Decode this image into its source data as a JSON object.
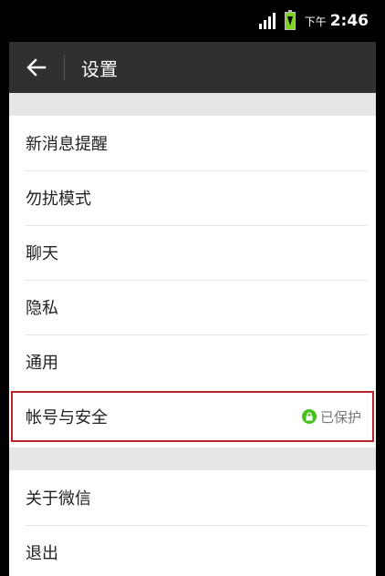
{
  "status_bar": {
    "time_period": "下午",
    "time": "2:46",
    "icons": [
      "signal-icon",
      "battery-charging-icon"
    ]
  },
  "header": {
    "back_icon": "arrow-left-icon",
    "title": "设置",
    "background": "#303033"
  },
  "settings": {
    "group1": [
      {
        "label": "新消息提醒"
      },
      {
        "label": "勿扰模式"
      },
      {
        "label": "聊天"
      },
      {
        "label": "隐私"
      },
      {
        "label": "通用"
      },
      {
        "label": "帐号与安全",
        "status": "已保护",
        "status_icon": "lock-icon",
        "highlighted": true
      }
    ],
    "group2": [
      {
        "label": "关于微信"
      },
      {
        "label": "退出"
      }
    ]
  },
  "colors": {
    "accent_green": "#45c01a",
    "highlight_border": "#b8252c",
    "section_gap": "#e6e6e6"
  }
}
